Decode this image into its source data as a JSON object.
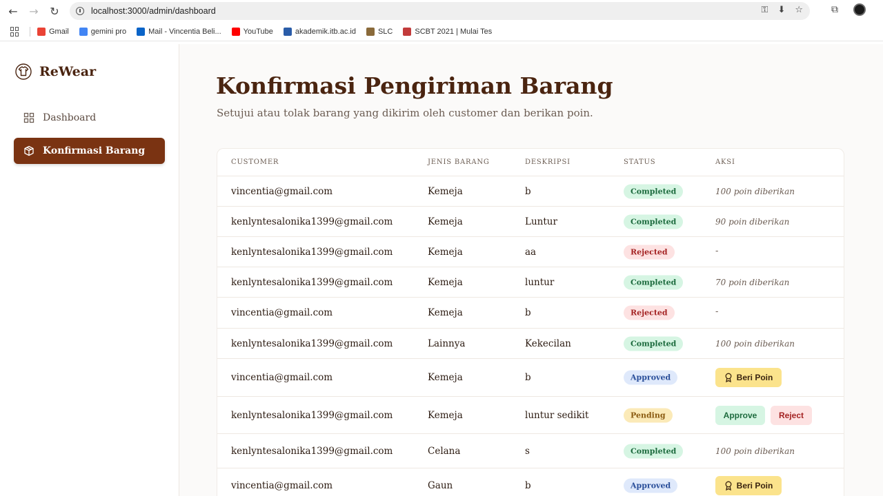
{
  "browser": {
    "url": "localhost:3000/admin/dashboard",
    "bookmarks": [
      {
        "label": "Gmail",
        "color": "#ea4335"
      },
      {
        "label": "gemini pro",
        "color": "#4285f4"
      },
      {
        "label": "Mail - Vincentia Beli...",
        "color": "#0a64c8"
      },
      {
        "label": "YouTube",
        "color": "#ff0000"
      },
      {
        "label": "akademik.itb.ac.id",
        "color": "#2a5ca8"
      },
      {
        "label": "SLC",
        "color": "#8a6a3a"
      },
      {
        "label": "SCBT 2021 | Mulai Tes",
        "color": "#c23b3b"
      }
    ]
  },
  "sidebar": {
    "brand": "ReWear",
    "items": [
      {
        "label": "Dashboard",
        "icon": "grid-icon"
      },
      {
        "label": "Konfirmasi Barang",
        "icon": "box-icon"
      }
    ]
  },
  "main": {
    "title": "Konfirmasi Pengiriman Barang",
    "subtitle": "Setujui atau tolak barang yang dikirim oleh customer dan berikan poin.",
    "columns": [
      "CUSTOMER",
      "JENIS BARANG",
      "DESKRIPSI",
      "STATUS",
      "AKSI"
    ],
    "rows": [
      {
        "customer": "vincentia@gmail.com",
        "jenis": "Kemeja",
        "deskripsi": "b",
        "status": "Completed",
        "status_class": "completed",
        "aksi_type": "text",
        "aksi": "100 poin diberikan"
      },
      {
        "customer": "kenlyntesalonika1399@gmail.com",
        "jenis": "Kemeja",
        "deskripsi": "Luntur",
        "status": "Completed",
        "status_class": "completed",
        "aksi_type": "text",
        "aksi": "90 poin diberikan"
      },
      {
        "customer": "kenlyntesalonika1399@gmail.com",
        "jenis": "Kemeja",
        "deskripsi": "aa",
        "status": "Rejected",
        "status_class": "rejected",
        "aksi_type": "dash",
        "aksi": "-"
      },
      {
        "customer": "kenlyntesalonika1399@gmail.com",
        "jenis": "Kemeja",
        "deskripsi": "luntur",
        "status": "Completed",
        "status_class": "completed",
        "aksi_type": "text",
        "aksi": "70 poin diberikan"
      },
      {
        "customer": "vincentia@gmail.com",
        "jenis": "Kemeja",
        "deskripsi": "b",
        "status": "Rejected",
        "status_class": "rejected",
        "aksi_type": "dash",
        "aksi": "-"
      },
      {
        "customer": "kenlyntesalonika1399@gmail.com",
        "jenis": "Lainnya",
        "deskripsi": "Kekecilan",
        "status": "Completed",
        "status_class": "completed",
        "aksi_type": "text",
        "aksi": "100 poin diberikan"
      },
      {
        "customer": "vincentia@gmail.com",
        "jenis": "Kemeja",
        "deskripsi": "b",
        "status": "Approved",
        "status_class": "approved",
        "aksi_type": "poin",
        "aksi": "Beri Poin"
      },
      {
        "customer": "kenlyntesalonika1399@gmail.com",
        "jenis": "Kemeja",
        "deskripsi": "luntur sedikit",
        "status": "Pending",
        "status_class": "pending",
        "aksi_type": "approve_reject",
        "aksi": "Approve",
        "aksi2": "Reject"
      },
      {
        "customer": "kenlyntesalonika1399@gmail.com",
        "jenis": "Celana",
        "deskripsi": "s",
        "status": "Completed",
        "status_class": "completed",
        "aksi_type": "text",
        "aksi": "100 poin diberikan"
      },
      {
        "customer": "vincentia@gmail.com",
        "jenis": "Gaun",
        "deskripsi": "b",
        "status": "Approved",
        "status_class": "approved",
        "aksi_type": "poin",
        "aksi": "Beri Poin"
      }
    ]
  }
}
